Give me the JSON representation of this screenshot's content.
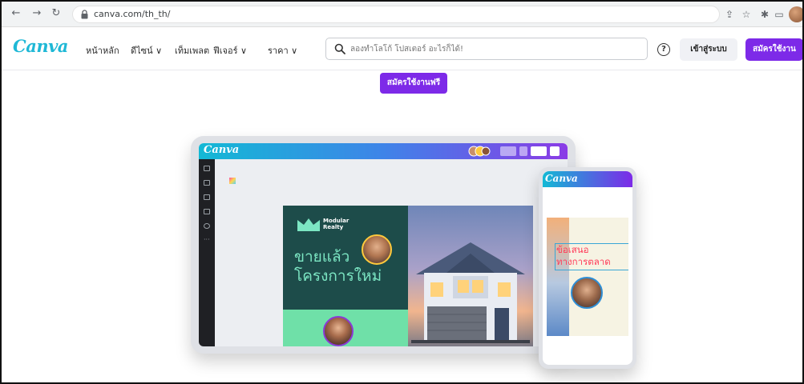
{
  "browser": {
    "url": "canva.com/th_th/"
  },
  "header": {
    "logo": "Canva",
    "nav": [
      {
        "label": "หน้าหลัก"
      },
      {
        "label": "ดีไซน์ ∨"
      },
      {
        "label": "เท็มเพลต"
      },
      {
        "label": "ฟีเจอร์ ∨"
      },
      {
        "label": "ราคา ∨"
      }
    ],
    "search_placeholder": "ลองทำโลโก้ โปสเตอร์ อะไรก็ได้!",
    "help_symbol": "?",
    "login_label": "เข้าสู่ระบบ",
    "signup_label": "สมัครใช้งาน"
  },
  "hero": {
    "cta_label": "สมัครใช้งานฟรี"
  },
  "mockup": {
    "editor_logo": "Canva",
    "brand_name_line1": "Modular",
    "brand_name_line2": "Realty",
    "headline_line1": "ขายแล้ว",
    "headline_line2": "โครงการใหม่",
    "phone_logo": "Canva",
    "offer_line1": "ข้อเสนอ",
    "offer_line2": "ทางการตลาด"
  },
  "colors": {
    "brand_purple": "#7d2ae8",
    "brand_teal": "#13b9d5"
  }
}
